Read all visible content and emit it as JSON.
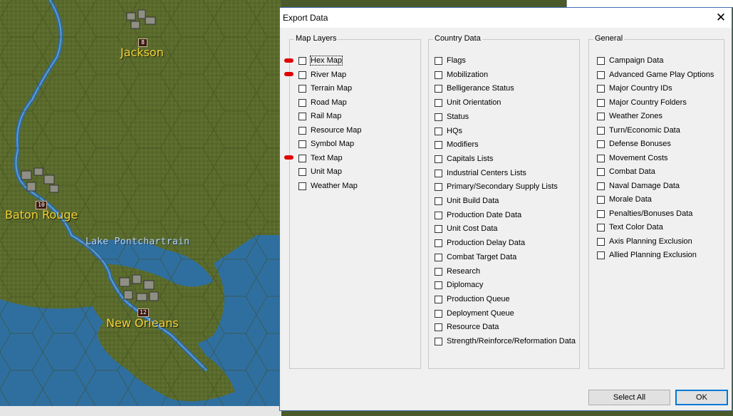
{
  "map": {
    "cities": [
      {
        "name": "Jackson",
        "badge": "8"
      },
      {
        "name": "Baton Rouge",
        "badge": "10"
      },
      {
        "name": "New Orleans",
        "badge": "12"
      }
    ],
    "lake_label": "Lake Pontchartrain"
  },
  "dialog": {
    "title": "Export Data",
    "close_glyph": "✕",
    "groups": {
      "map_layers": {
        "title": "Map Layers",
        "items": [
          "Hex Map",
          "River Map",
          "Terrain Map",
          "Road Map",
          "Rail Map",
          "Resource Map",
          "Symbol Map",
          "Text Map",
          "Unit Map",
          "Weather Map"
        ]
      },
      "country_data": {
        "title": "Country Data",
        "items": [
          "Flags",
          "Mobilization",
          "Belligerance Status",
          "Unit Orientation",
          "Status",
          "HQs",
          "Modifiers",
          "Capitals Lists",
          "Industrial Centers Lists",
          "Primary/Secondary Supply Lists",
          "Unit Build Data",
          "Production Date Data",
          "Unit Cost Data",
          "Production Delay Data",
          "Combat Target Data",
          "Research",
          "Diplomacy",
          "Production Queue",
          "Deployment Queue",
          "Resource Data",
          "Strength/Reinforce/Reformation Data"
        ]
      },
      "general": {
        "title": "General",
        "items": [
          "Campaign Data",
          "Advanced Game Play Options",
          "Major Country IDs",
          "Major Country Folders",
          "Weather Zones",
          "Turn/Economic Data",
          "Defense Bonuses",
          "Movement Costs",
          "Combat Data",
          "Naval Damage Data",
          "Morale Data",
          "Penalties/Bonuses Data",
          "Text Color Data",
          "Axis Planning Exclusion",
          "Allied Planning Exclusion"
        ]
      }
    },
    "buttons": {
      "select_all": "Select All",
      "ok": "OK"
    },
    "colors": {
      "marker": "#e00000",
      "border": "#3f6fb5"
    }
  }
}
